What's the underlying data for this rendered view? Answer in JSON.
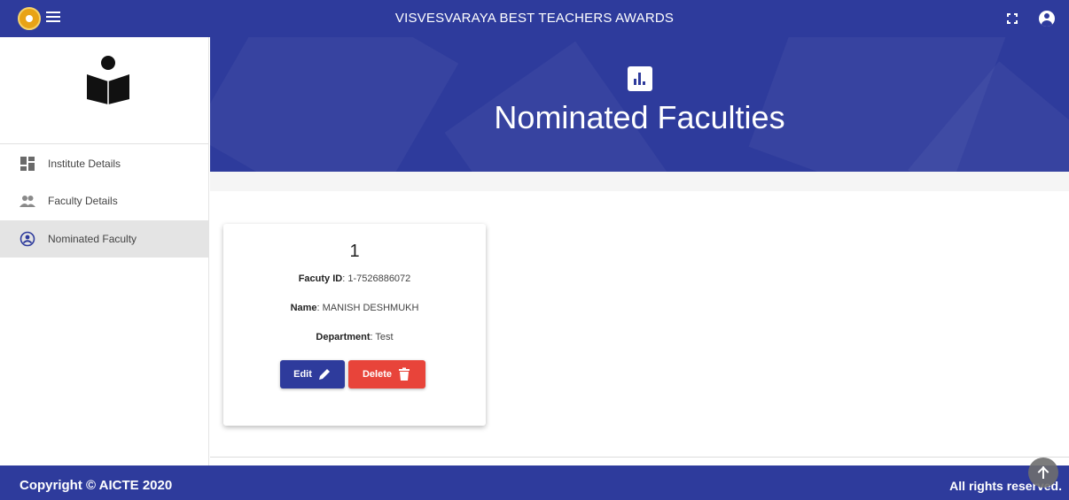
{
  "header": {
    "title": "VISVESVARAYA BEST TEACHERS AWARDS"
  },
  "sidebar": {
    "items": [
      {
        "label": "Institute Details",
        "icon": "dashboard-icon"
      },
      {
        "label": "Faculty Details",
        "icon": "people-icon"
      },
      {
        "label": "Nominated Faculty",
        "icon": "user-circle-icon",
        "active": true
      }
    ]
  },
  "hero": {
    "heading": "Nominated Faculties",
    "icon": "bar-chart-icon"
  },
  "card": {
    "number": "1",
    "faculty_id_label": "Facuty ID",
    "faculty_id_value": ": 1-7526886072",
    "name_label": "Name",
    "name_value": ": MANISH DESHMUKH",
    "department_label": "Department",
    "department_value": ": Test",
    "edit_label": "Edit",
    "delete_label": "Delete"
  },
  "footer": {
    "copyright": "Copyright © AICTE 2020",
    "rights": "All rights reserved."
  },
  "colors": {
    "primary": "#2e3b9c",
    "danger": "#e8443a",
    "active_nav": "#e4e4e4"
  }
}
